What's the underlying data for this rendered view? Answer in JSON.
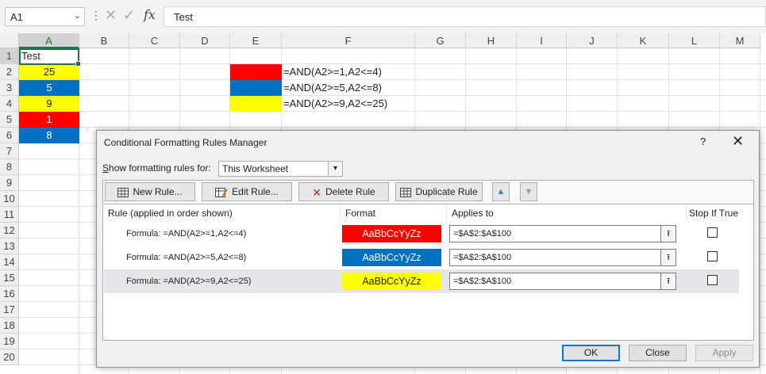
{
  "formula_bar": {
    "name_box": "A1",
    "formula": "Test",
    "icons": [
      "more-options-icon",
      "cancel-icon",
      "enter-icon",
      "insert-function-icon"
    ],
    "fx_label": "fx"
  },
  "sheet": {
    "columns": [
      "A",
      "B",
      "C",
      "D",
      "E",
      "F",
      "G",
      "H",
      "I",
      "J",
      "K",
      "L",
      "M"
    ],
    "rows": [
      "1",
      "2",
      "3",
      "4",
      "5",
      "6",
      "7",
      "8",
      "9",
      "10",
      "11",
      "12",
      "13",
      "14",
      "15",
      "16",
      "17",
      "18",
      "19",
      "20"
    ],
    "cells": {
      "A1": "Test",
      "A2": "25",
      "A3": "5",
      "A4": "9",
      "A5": "1",
      "A6": "8",
      "F2": "=AND(A2>=1,A2<=4)",
      "F3": "=AND(A2>=5,A2<=8)",
      "F4": "=AND(A2>=9,A2<=25)"
    },
    "fills": {
      "red": "#ff0000",
      "blue": "#0070c0",
      "yellow": "#ffff00"
    }
  },
  "dialog": {
    "title": "Conditional Formatting Rules Manager",
    "help": "?",
    "close": "✕",
    "show_rules_label": "Show formatting rules for:",
    "show_rules_value": "This Worksheet",
    "buttons": {
      "new_rule": "New Rule...",
      "edit_rule": "Edit Rule...",
      "delete_rule": "Delete Rule",
      "duplicate_rule": "Duplicate Rule",
      "move_up": "▲",
      "move_down": "▼",
      "ok": "OK",
      "close": "Close",
      "apply": "Apply"
    },
    "columns": {
      "rule": "Rule (applied in order shown)",
      "format": "Format",
      "applies_to": "Applies to",
      "stop_if_true": "Stop If True"
    },
    "rules": [
      {
        "rule": "Formula: =AND(A2>=1,A2<=4)",
        "format": "AaBbCcYyZz",
        "applies_to": "=$A$2:$A$100",
        "fill": "#ff0000",
        "text_color": "#ffffff",
        "stop_if_true": false,
        "selected": false
      },
      {
        "rule": "Formula: =AND(A2>=5,A2<=8)",
        "format": "AaBbCcYyZz",
        "applies_to": "=$A$2:$A$100",
        "fill": "#0070c0",
        "text_color": "#ffffff",
        "stop_if_true": false,
        "selected": false
      },
      {
        "rule": "Formula: =AND(A2>=9,A2<=25)",
        "format": "AaBbCcYyZz",
        "applies_to": "=$A$2:$A$100",
        "fill": "#ffff00",
        "text_color": "#222222",
        "stop_if_true": false,
        "selected": true
      }
    ]
  }
}
